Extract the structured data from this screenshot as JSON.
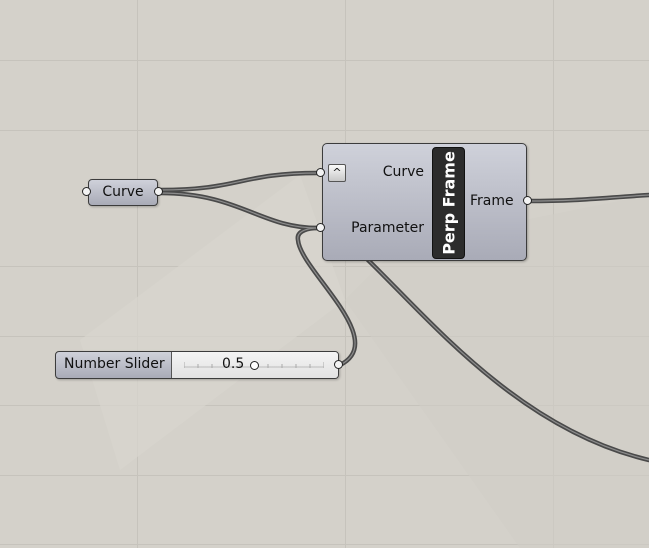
{
  "canvas": {
    "background": "#d4d1ca",
    "wire_color": "#4a4a4a"
  },
  "curve_param": {
    "label": "Curve"
  },
  "perp_frame": {
    "name": "Perp Frame",
    "toggle_icon": "chevron-up-icon",
    "toggle_glyph": "^",
    "inputs": {
      "curve": "Curve",
      "parameter": "Parameter"
    },
    "outputs": {
      "frame": "Frame"
    }
  },
  "number_slider": {
    "label": "Number Slider",
    "value": "0.5"
  }
}
